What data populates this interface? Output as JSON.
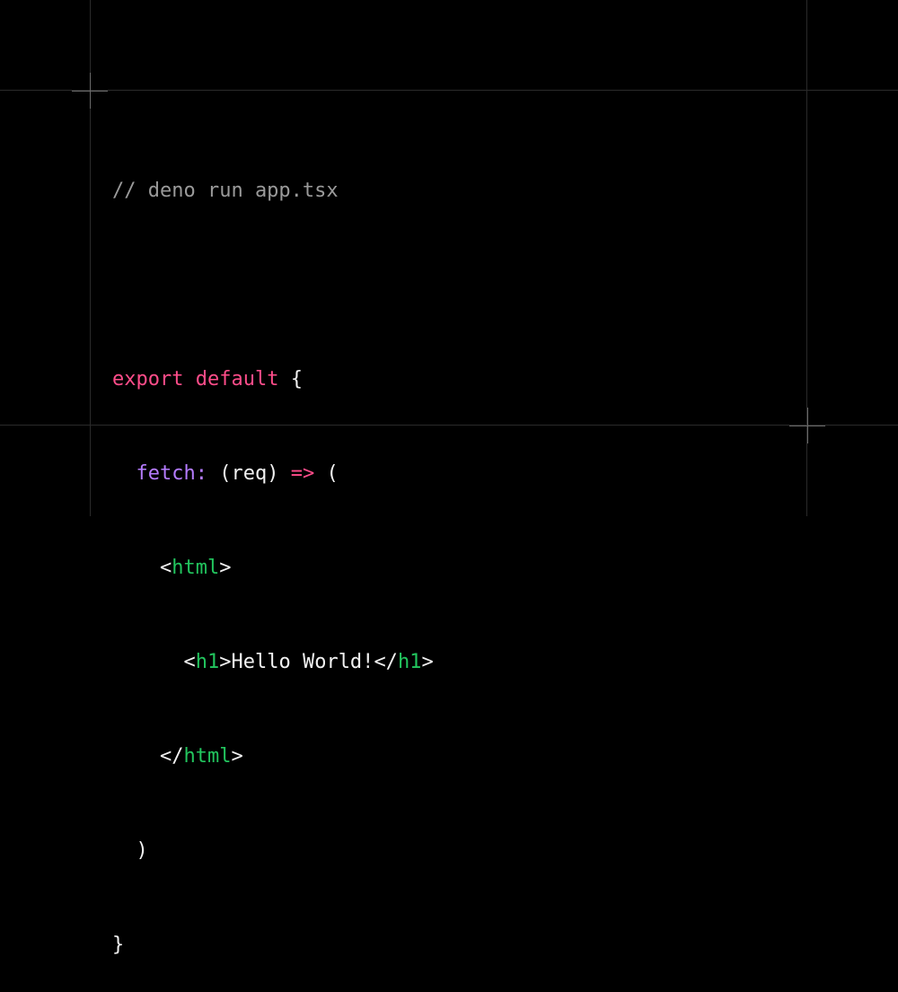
{
  "code": {
    "comment": "// deno run app.tsx",
    "kw_export": "export",
    "kw_default": "default",
    "open_brace": "{",
    "fetch_prop": "fetch:",
    "req_param": "(req)",
    "arrow": "=>",
    "open_paren": "(",
    "lt": "<",
    "gt": ">",
    "lt_slash": "</",
    "tag_html": "html",
    "tag_h1": "h1",
    "hello_text": "Hello World!",
    "close_paren": ")",
    "close_brace": "}"
  },
  "colors": {
    "background": "#000000",
    "comment": "#9a9a9a",
    "keyword": "#ff4d8a",
    "property": "#b57cff",
    "tag": "#22c55e",
    "text": "#f2f2f2",
    "guide": "#2a2a2a"
  }
}
